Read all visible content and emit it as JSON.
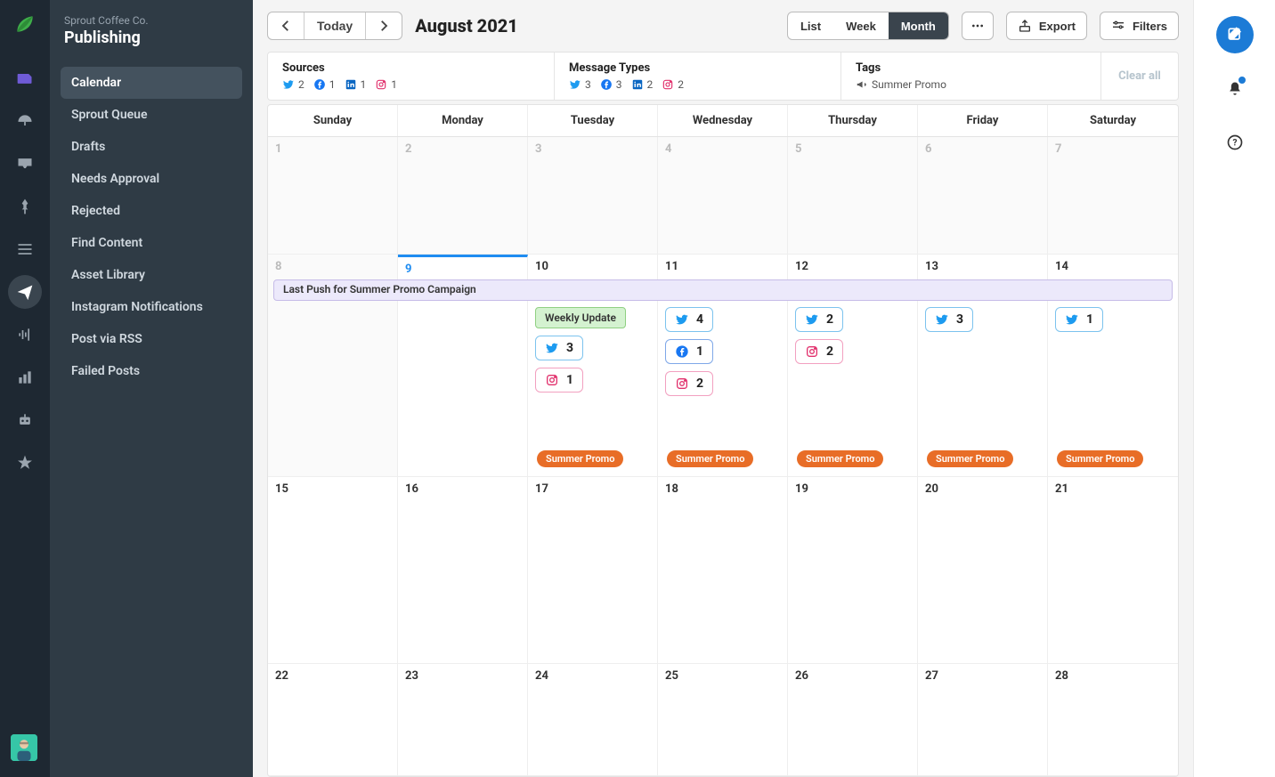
{
  "org_name": "Sprout Coffee Co.",
  "section_title": "Publishing",
  "secondary_nav": [
    "Calendar",
    "Sprout Queue",
    "Drafts",
    "Needs Approval",
    "Rejected",
    "Find Content",
    "Asset Library",
    "Instagram Notifications",
    "Post via RSS",
    "Failed Posts"
  ],
  "active_nav_index": 0,
  "toolbar": {
    "today_label": "Today",
    "month_label": "August 2021",
    "views": {
      "list": "List",
      "week": "Week",
      "month": "Month"
    },
    "active_view": "Month",
    "export_label": "Export",
    "filters_label": "Filters"
  },
  "filter_bar": {
    "sources": {
      "title": "Sources",
      "items": [
        {
          "network": "twitter",
          "count": "2"
        },
        {
          "network": "facebook",
          "count": "1"
        },
        {
          "network": "linkedin",
          "count": "1"
        },
        {
          "network": "instagram",
          "count": "1"
        }
      ]
    },
    "message_types": {
      "title": "Message Types",
      "items": [
        {
          "network": "twitter",
          "count": "3"
        },
        {
          "network": "facebook",
          "count": "3"
        },
        {
          "network": "linkedin",
          "count": "2"
        },
        {
          "network": "instagram",
          "count": "2"
        }
      ]
    },
    "tags": {
      "title": "Tags",
      "items": [
        {
          "label": "Summer Promo"
        }
      ]
    },
    "clear_label": "Clear all"
  },
  "days_of_week": [
    "Sunday",
    "Monday",
    "Tuesday",
    "Wednesday",
    "Thursday",
    "Friday",
    "Saturday"
  ],
  "weeks": [
    {
      "days": [
        {
          "n": "1",
          "prev": true
        },
        {
          "n": "2",
          "prev": true
        },
        {
          "n": "3",
          "prev": true
        },
        {
          "n": "4",
          "prev": true
        },
        {
          "n": "5",
          "prev": true
        },
        {
          "n": "6",
          "prev": true
        },
        {
          "n": "7",
          "prev": true
        }
      ]
    },
    {
      "span_bar": "Last Push for Summer Promo Campaign",
      "days": [
        {
          "n": "8",
          "prev": true
        },
        {
          "n": "9",
          "today": true
        },
        {
          "n": "10",
          "note": "Weekly Update",
          "chips": [
            {
              "net": "twitter",
              "v": "3"
            },
            {
              "net": "instagram",
              "v": "1"
            }
          ],
          "tag": "Summer Promo"
        },
        {
          "n": "11",
          "chips": [
            {
              "net": "twitter",
              "v": "4"
            },
            {
              "net": "facebook",
              "v": "1"
            },
            {
              "net": "instagram",
              "v": "2"
            }
          ],
          "tag": "Summer Promo"
        },
        {
          "n": "12",
          "chips": [
            {
              "net": "twitter",
              "v": "2"
            },
            {
              "net": "instagram",
              "v": "2"
            }
          ],
          "tag": "Summer Promo"
        },
        {
          "n": "13",
          "chips": [
            {
              "net": "twitter",
              "v": "3"
            }
          ],
          "tag": "Summer Promo"
        },
        {
          "n": "14",
          "chips": [
            {
              "net": "twitter",
              "v": "1"
            }
          ],
          "tag": "Summer Promo"
        }
      ]
    },
    {
      "days": [
        {
          "n": "15"
        },
        {
          "n": "16"
        },
        {
          "n": "17"
        },
        {
          "n": "18"
        },
        {
          "n": "19"
        },
        {
          "n": "20"
        },
        {
          "n": "21"
        }
      ]
    },
    {
      "days": [
        {
          "n": "22"
        },
        {
          "n": "23"
        },
        {
          "n": "24"
        },
        {
          "n": "25"
        },
        {
          "n": "26"
        },
        {
          "n": "27"
        },
        {
          "n": "28"
        }
      ]
    }
  ]
}
